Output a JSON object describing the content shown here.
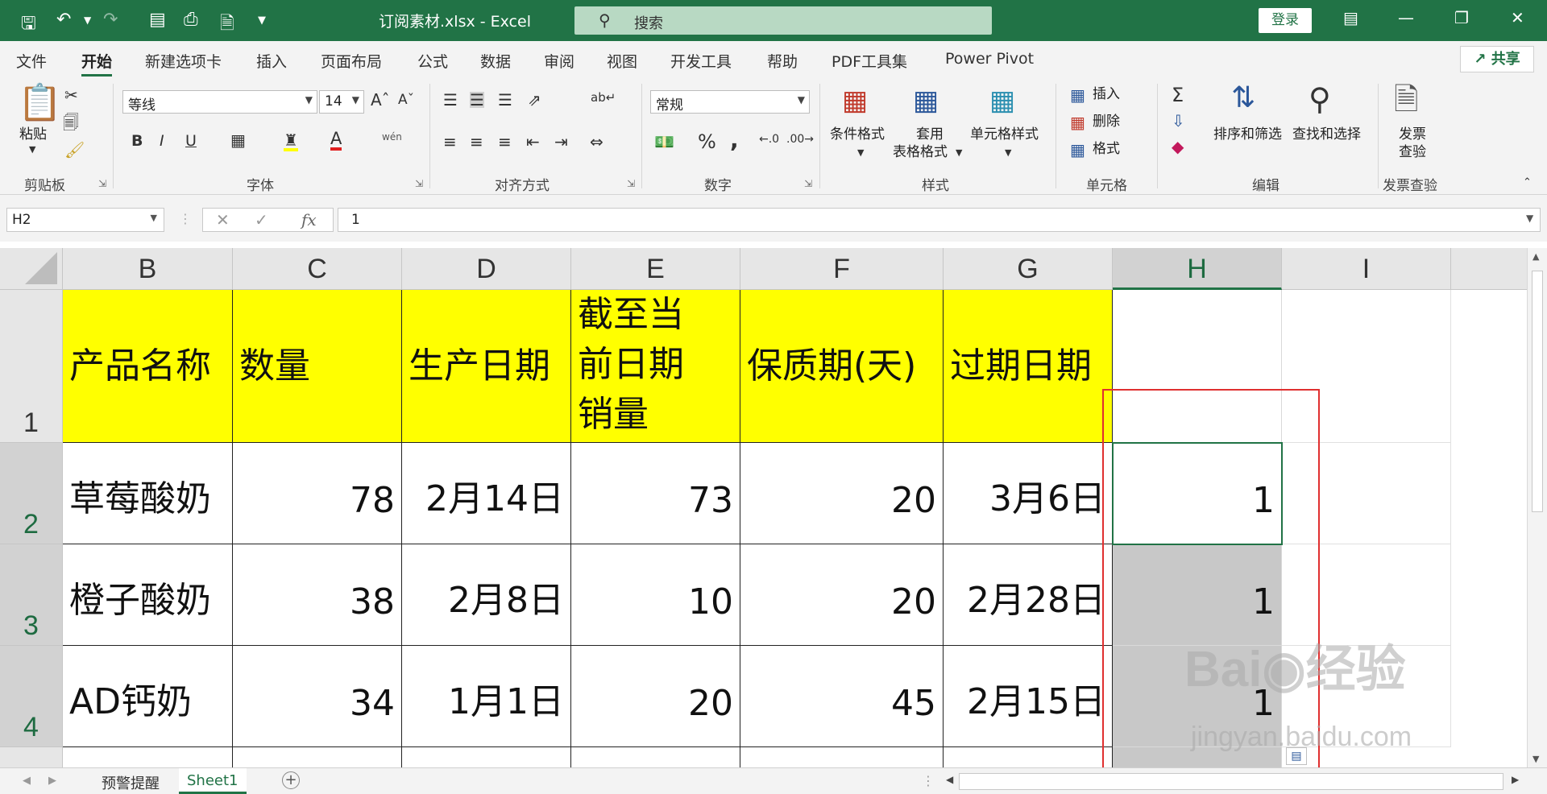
{
  "titlebar": {
    "doc_title": "订阅素材.xlsx  -  Excel",
    "search_placeholder": "搜索",
    "login_label": "登录"
  },
  "menu": {
    "tabs": [
      "文件",
      "开始",
      "新建选项卡",
      "插入",
      "页面布局",
      "公式",
      "数据",
      "审阅",
      "视图",
      "开发工具",
      "帮助",
      "PDF工具集",
      "Power Pivot"
    ],
    "active": "开始",
    "share_label": "共享"
  },
  "ribbon": {
    "clipboard": {
      "paste_label": "粘贴",
      "group_label": "剪贴板"
    },
    "font": {
      "font_name": "等线",
      "font_size": "14",
      "group_label": "字体",
      "bold": "B",
      "italic": "I",
      "underline": "U",
      "phonetic": "wén"
    },
    "alignment": {
      "group_label": "对齐方式"
    },
    "number": {
      "format": "常规",
      "group_label": "数字",
      "percent": "%",
      "comma": ","
    },
    "styles": {
      "conditional": "条件格式",
      "table_format_1": "套用",
      "table_format_2": "表格格式",
      "cell_styles": "单元格样式",
      "group_label": "样式"
    },
    "cells": {
      "insert": "插入",
      "delete": "删除",
      "format": "格式",
      "group_label": "单元格"
    },
    "editing": {
      "sort_filter": "排序和筛选",
      "find_select": "查找和选择",
      "group_label": "编辑"
    },
    "invoice": {
      "label_1": "发票",
      "label_2": "查验",
      "group_label": "发票查验"
    }
  },
  "formula_bar": {
    "name_box": "H2",
    "fx": "fx",
    "formula": "1"
  },
  "sheet": {
    "columns": [
      "B",
      "C",
      "D",
      "E",
      "F",
      "G",
      "H",
      "I"
    ],
    "selected_column": "H",
    "rows": [
      "1",
      "2",
      "3",
      "4"
    ],
    "header_row": [
      "产品名称",
      "数量",
      "生产日期",
      "截至当前日期销量",
      "保质期(天)",
      "过期日期"
    ],
    "data_rows": [
      [
        "草莓酸奶",
        "78",
        "2月14日",
        "73",
        "20",
        "3月6日",
        "1"
      ],
      [
        "橙子酸奶",
        "38",
        "2月8日",
        "10",
        "20",
        "2月28日",
        "1"
      ],
      [
        "AD钙奶",
        "34",
        "1月1日",
        "20",
        "45",
        "2月15日",
        "1"
      ]
    ]
  },
  "sheet_tabs": [
    "预警提醒",
    "Sheet1"
  ],
  "active_sheet": "Sheet1",
  "colors": {
    "excel_green": "#217346",
    "header_fill": "#ffff00",
    "highlight": "#e03030"
  }
}
